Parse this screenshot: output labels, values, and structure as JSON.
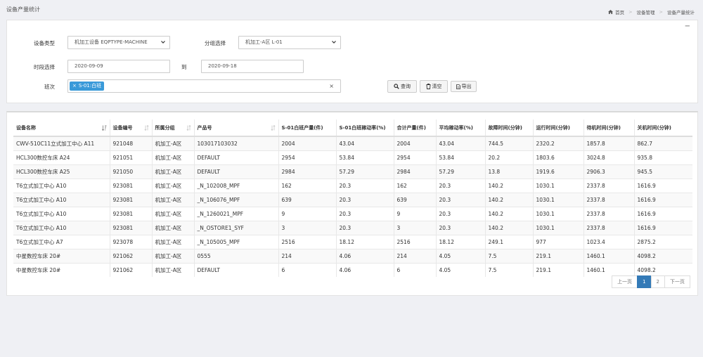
{
  "page": {
    "title": "设备产量统计"
  },
  "breadcrumb": {
    "home": "首页",
    "level2": "设备管理",
    "current": "设备产量统计"
  },
  "filters": {
    "collapse_label": "−",
    "device_type_label": "设备类型",
    "device_type_value": "机加工设备 EQPTYPE-MACHINE",
    "group_label": "分组选择",
    "group_value": "机加工-A区 L-01",
    "period_label": "时段选择",
    "date_from": "2020-09-09",
    "to_label": "到",
    "date_to": "2020-09-18",
    "shift_label": "班次",
    "shift_tag": "S-01:白班",
    "shift_tag_remove": "×",
    "clear_x": "×",
    "query_button": "查询",
    "clear_button": "清空",
    "export_button": "导出"
  },
  "table": {
    "headers": [
      "设备名称",
      "设备编号",
      "所属分组",
      "产品号",
      "S-01白班产量(件)",
      "S-01白班稼动率(%)",
      "合计产量(件)",
      "平均稼动率(%)",
      "故障时间(分钟)",
      "运行时间(分钟)",
      "待机时间(分钟)",
      "关机时间(分钟)"
    ],
    "rows": [
      [
        "CWV-510C11立式加工中心 A11",
        "921048",
        "机加工-A区",
        "103017103032",
        "2004",
        "43.04",
        "2004",
        "43.04",
        "744.5",
        "2320.2",
        "1857.8",
        "862.7"
      ],
      [
        "HCL300数控车床 A24",
        "921051",
        "机加工-A区",
        "DEFAULT",
        "2954",
        "53.84",
        "2954",
        "53.84",
        "20.2",
        "1803.6",
        "3024.8",
        "935.8"
      ],
      [
        "HCL300数控车床 A25",
        "921050",
        "机加工-A区",
        "DEFAULT",
        "2984",
        "57.29",
        "2984",
        "57.29",
        "13.8",
        "1919.6",
        "2906.3",
        "945.5"
      ],
      [
        "T6立式加工中心 A10",
        "923081",
        "机加工-A区",
        "_N_102008_MPF",
        "162",
        "20.3",
        "162",
        "20.3",
        "140.2",
        "1030.1",
        "2337.8",
        "1616.9"
      ],
      [
        "T6立式加工中心 A10",
        "923081",
        "机加工-A区",
        "_N_106076_MPF",
        "639",
        "20.3",
        "639",
        "20.3",
        "140.2",
        "1030.1",
        "2337.8",
        "1616.9"
      ],
      [
        "T6立式加工中心 A10",
        "923081",
        "机加工-A区",
        "_N_1260021_MPF",
        "9",
        "20.3",
        "9",
        "20.3",
        "140.2",
        "1030.1",
        "2337.8",
        "1616.9"
      ],
      [
        "T6立式加工中心 A10",
        "923081",
        "机加工-A区",
        "_N_OSTORE1_SYF",
        "3",
        "20.3",
        "3",
        "20.3",
        "140.2",
        "1030.1",
        "2337.8",
        "1616.9"
      ],
      [
        "T6立式加工中心 A7",
        "923078",
        "机加工-A区",
        "_N_105005_MPF",
        "2516",
        "18.12",
        "2516",
        "18.12",
        "249.1",
        "977",
        "1023.4",
        "2875.2"
      ],
      [
        "中星数控车床 20#",
        "921062",
        "机加工-A区",
        "0555",
        "214",
        "4.06",
        "214",
        "4.05",
        "7.5",
        "219.1",
        "1460.1",
        "4098.2"
      ],
      [
        "中星数控车床 20#",
        "921062",
        "机加工-A区",
        "DEFAULT",
        "6",
        "4.06",
        "6",
        "4.05",
        "7.5",
        "219.1",
        "1460.1",
        "4098.2"
      ]
    ]
  },
  "pagination": {
    "prev": "上一页",
    "pages": [
      "1",
      "2"
    ],
    "next": "下一页",
    "current": "1"
  }
}
